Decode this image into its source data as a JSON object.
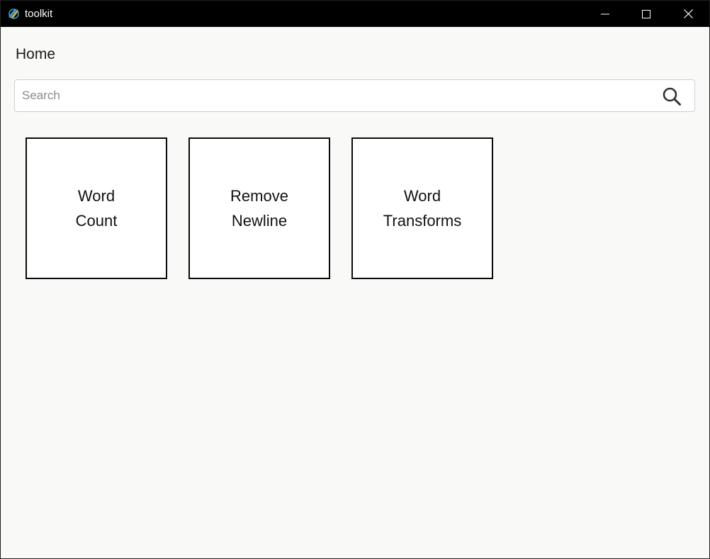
{
  "window": {
    "title": "toolkit",
    "icon": "app-logo-icon",
    "controls": {
      "minimize_icon": "minimize-icon",
      "maximize_icon": "maximize-icon",
      "close_icon": "close-icon"
    }
  },
  "page": {
    "title": "Home"
  },
  "search": {
    "placeholder": "Search",
    "value": "",
    "icon": "search-icon"
  },
  "tools": [
    {
      "line1": "Word",
      "line2": "Count"
    },
    {
      "line1": "Remove",
      "line2": "Newline"
    },
    {
      "line1": "Word",
      "line2": "Transforms"
    }
  ],
  "colors": {
    "titlebar": "#000000",
    "background": "#f9f9f7",
    "tile_border": "#0a0a0a",
    "search_border": "#cfcfcf"
  }
}
